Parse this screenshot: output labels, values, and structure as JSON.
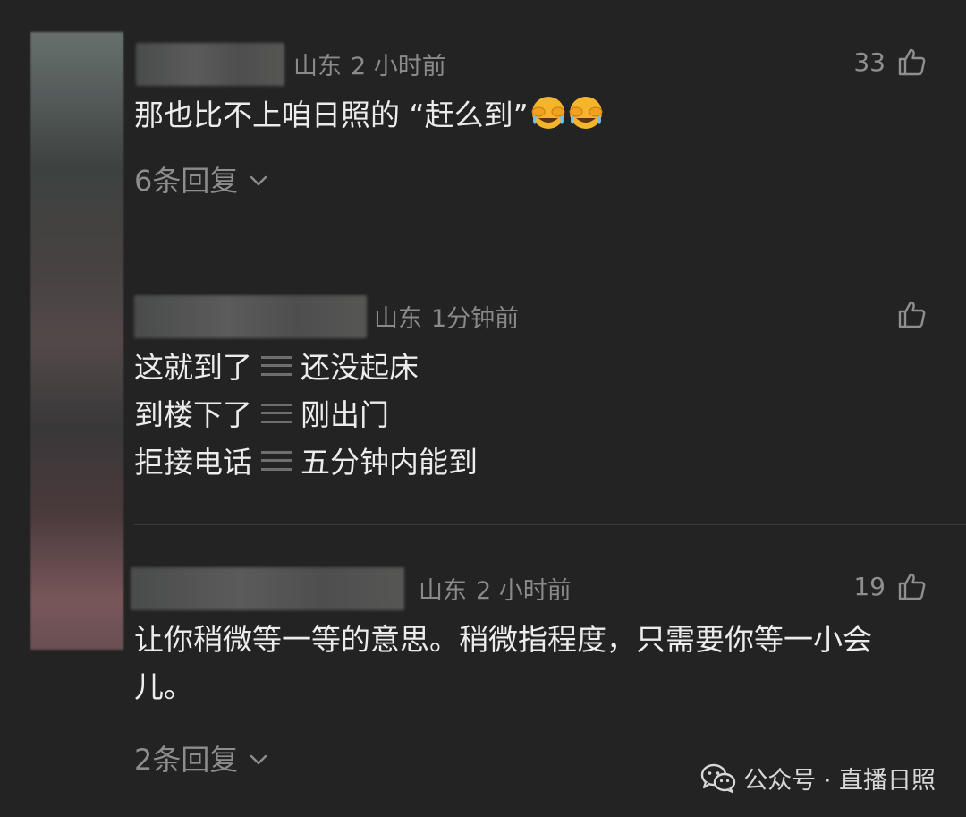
{
  "comments": [
    {
      "location": "山东",
      "time": "2 小时前",
      "likes": "33",
      "text": "那也比不上咱日照的 “赶么到”",
      "emoji": [
        "face-with-tears-of-joy-covering-eyes-emoji",
        "face-with-tears-of-joy-covering-eyes-emoji"
      ],
      "replies": "6条回复"
    },
    {
      "location": "山东",
      "time": "1分钟前",
      "likes": "",
      "lines": [
        {
          "left": "这就到了",
          "right": "还没起床"
        },
        {
          "left": "到楼下了",
          "right": "刚出门"
        },
        {
          "left": "拒接电话",
          "right": "五分钟内能到"
        }
      ]
    },
    {
      "location": "山东",
      "time": "2 小时前",
      "likes": "19",
      "text": "让你稍微等一等的意思。稍微指程度，只需要你等一小会儿。",
      "replies": "2条回复"
    }
  ],
  "watermark": {
    "icon": "wechat-icon",
    "text": "公众号 · 直播日照"
  },
  "colors": {
    "background": "#232323",
    "text": "#ececec",
    "meta": "#8a8a8a"
  }
}
